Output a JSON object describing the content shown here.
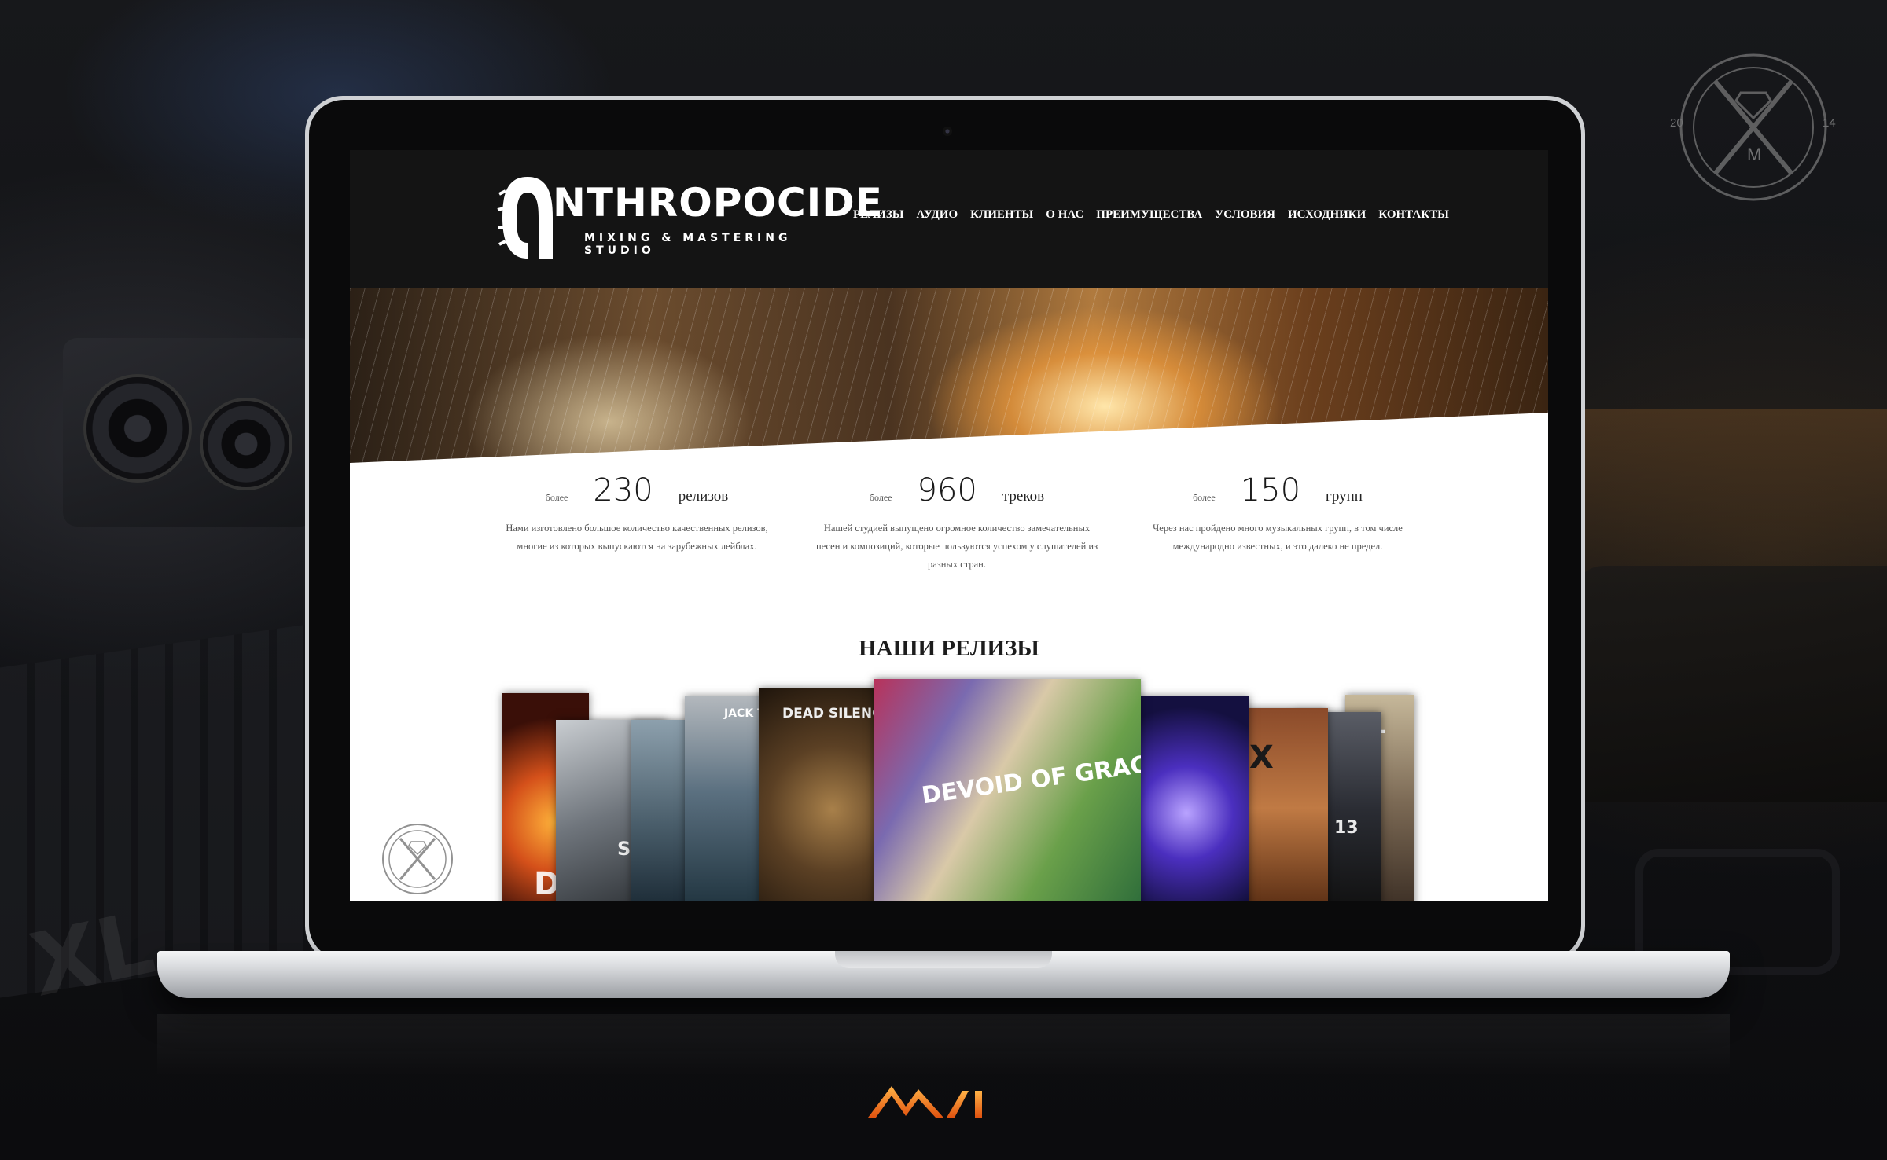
{
  "site": {
    "logo_text": "NTHROPOCIDE",
    "logo_tagline": "MIXING & MASTERING STUDIO",
    "nav": [
      {
        "label": "РЕЛИЗЫ"
      },
      {
        "label": "АУДИО"
      },
      {
        "label": "КЛИЕНТЫ"
      },
      {
        "label": "О НАС"
      },
      {
        "label": "ПРЕИМУЩЕСТВА"
      },
      {
        "label": "УСЛОВИЯ"
      },
      {
        "label": "ИСХОДНИКИ"
      },
      {
        "label": "КОНТАКТЫ"
      }
    ],
    "stats": [
      {
        "prefix": "более",
        "number": "230",
        "unit": "релизов",
        "desc": "Нами изготовлено большое количество качественных релизов, многие из которых выпускаются на зарубежных лейблах."
      },
      {
        "prefix": "более",
        "number": "960",
        "unit": "треков",
        "desc": "Нашей студией выпущено огромное количество замечательных песен и композиций, которые пользуются успехом у слушателей из разных стран."
      },
      {
        "prefix": "более",
        "number": "150",
        "unit": "групп",
        "desc": "Через нас пройдено много музыкальных групп, в том числе международно известных, и это далеко не предел."
      }
    ],
    "releases_title": "НАШИ РЕЛИЗЫ",
    "covers": [
      {
        "text": "D"
      },
      {
        "text": "SI"
      },
      {
        "text": "JACK THE FLIPPER"
      },
      {
        "text": "DEAD SILENCE HID"
      },
      {
        "text": "DEVOID OF GRACE"
      },
      {
        "text": ""
      },
      {
        "text": "X"
      },
      {
        "text": "13"
      },
      {
        "text": "T"
      }
    ]
  },
  "emblem": {
    "year_left": "20",
    "year_right": "14",
    "letter": "M"
  },
  "colors": {
    "brand_orange": "#f07a1a",
    "header_bg": "#141414",
    "screen_bg": "#ffffff"
  }
}
